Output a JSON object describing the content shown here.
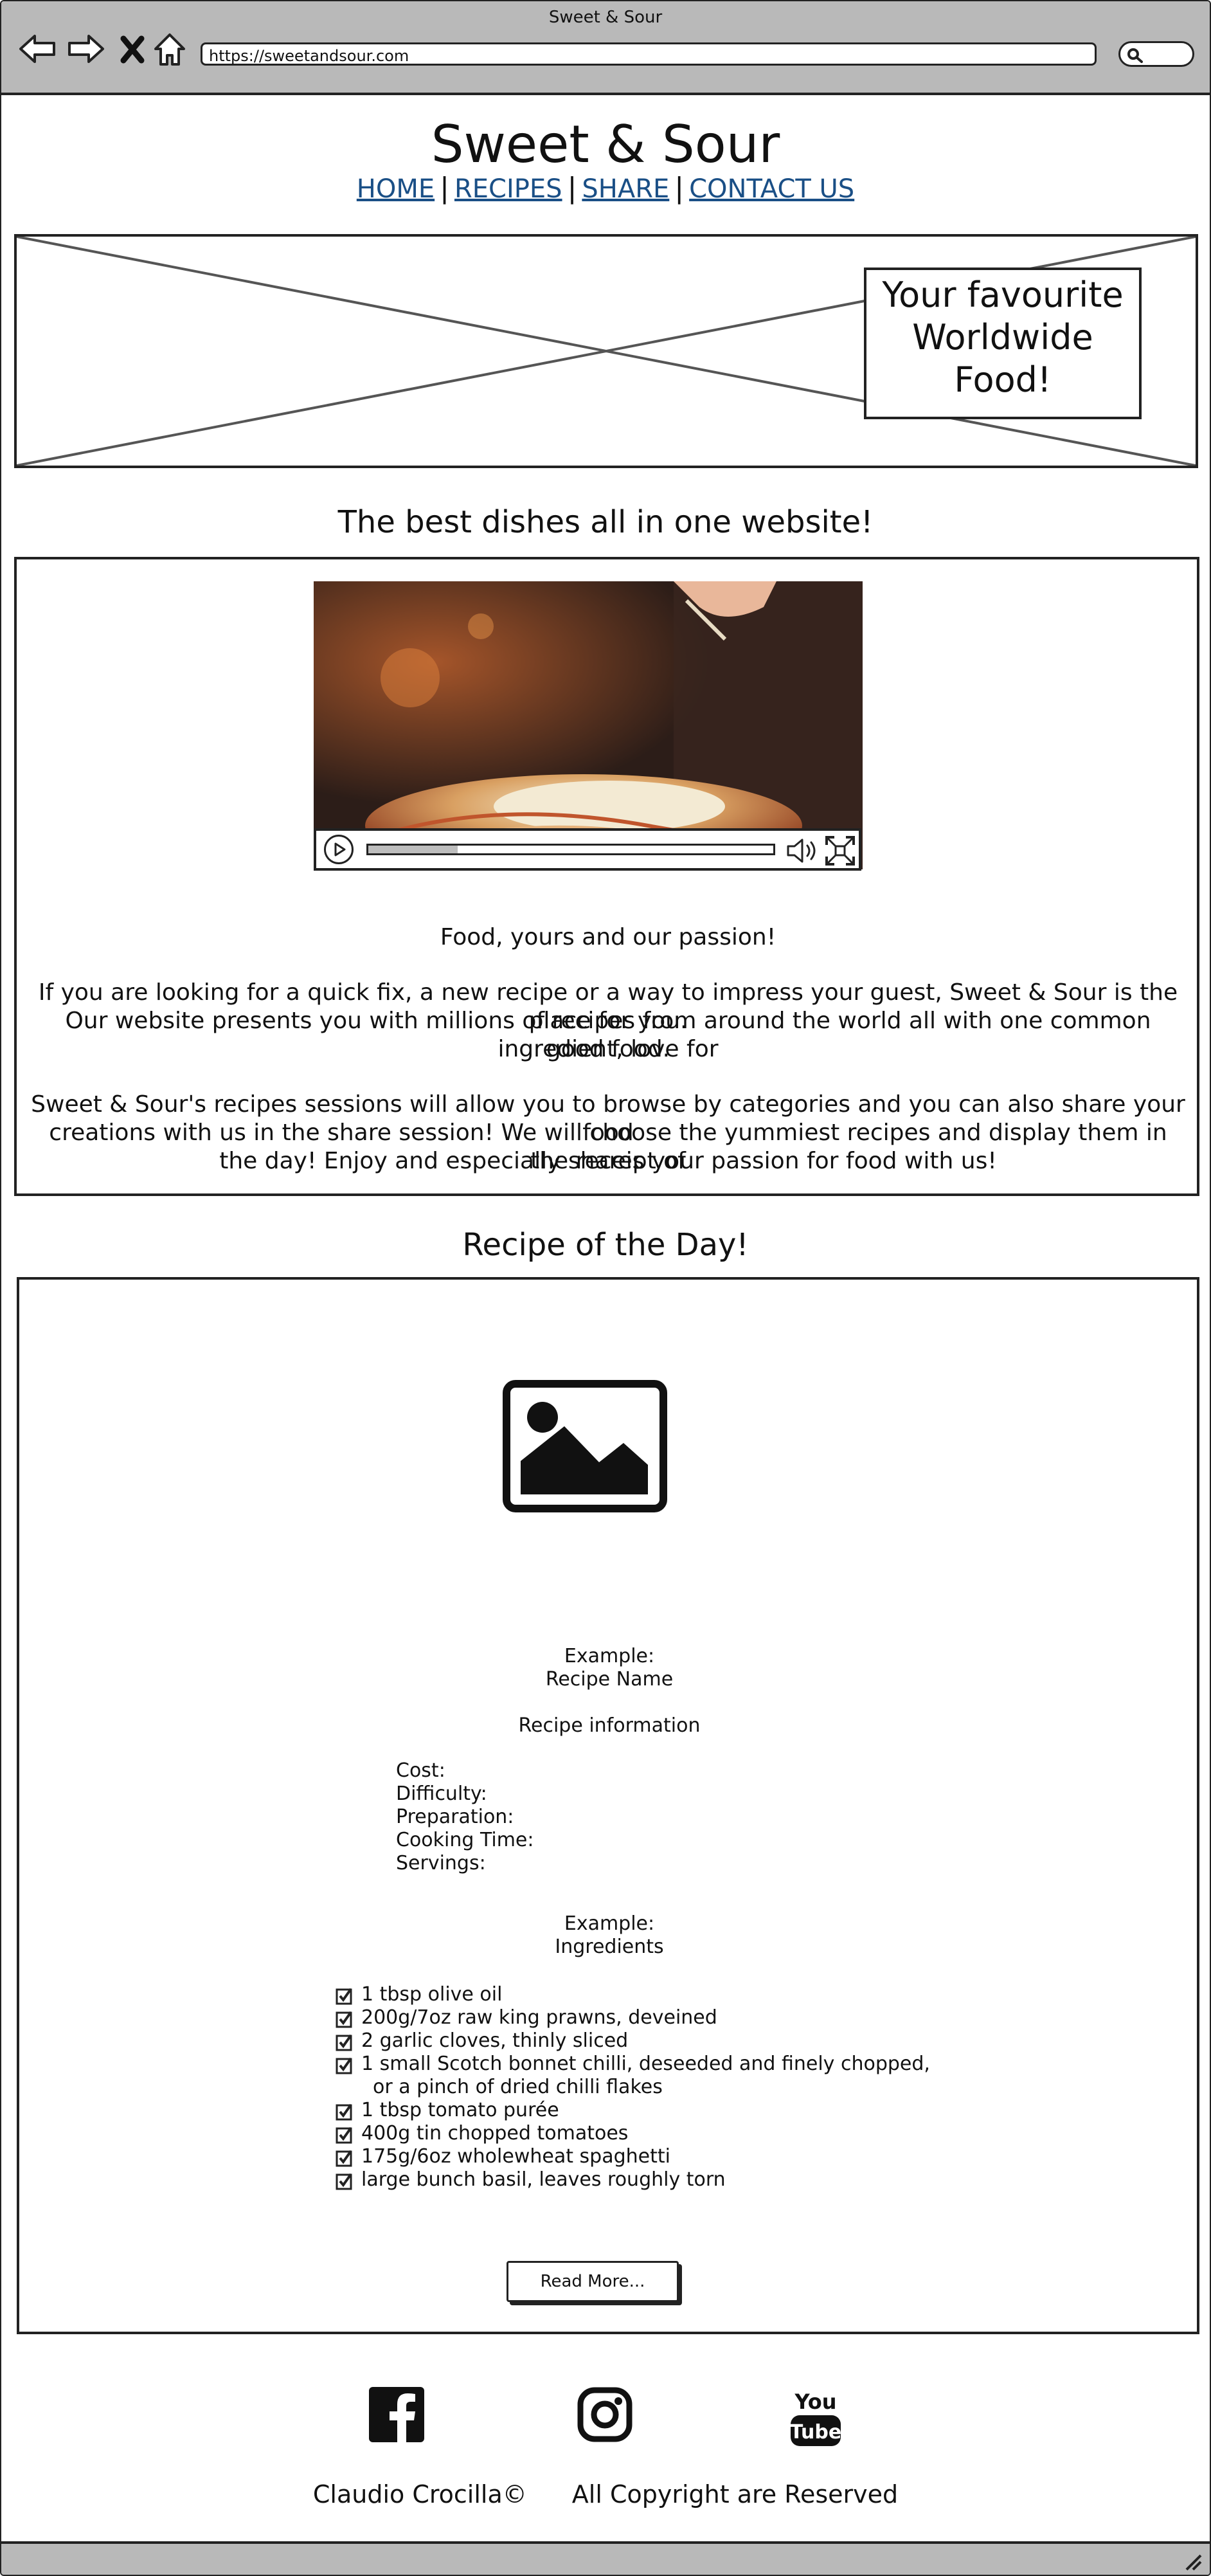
{
  "browser": {
    "window_title": "Sweet & Sour",
    "url": "https://sweetandsour.com",
    "icons": [
      "back-arrow-icon",
      "forward-arrow-icon",
      "close-x-icon",
      "home-icon",
      "search-icon"
    ]
  },
  "header": {
    "site_title": "Sweet & Sour",
    "nav": {
      "home": "HOME",
      "recipes": "RECIPES",
      "share": "SHARE",
      "contact": "CONTACT US",
      "separator": "|"
    }
  },
  "hero": {
    "callout_line1": "Your favourite",
    "callout_line2": "Worldwide",
    "callout_line3": "Food!"
  },
  "intro": {
    "heading": "The best dishes all in one website!",
    "video_progress": 0.22,
    "tagline": "Food, yours and our passion!",
    "para1_line1": "If you are looking for a quick fix, a new recipe or a way to impress your guest, Sweet & Sour is the place for you.",
    "para1_line2": "Our website presents you with millions of recipes from around the world all with one common ingredient, love for",
    "para1_line3": "good food.",
    "para2_line1": "Sweet & Sour's recipes sessions will allow you to browse by categories and you can also share your food",
    "para2_line2": "creations with us in the share session! We will choose the yummiest recipes and display them in the receipt of",
    "para2_line3": "the day! Enjoy and especially shares your passion for food with us!"
  },
  "recipe": {
    "heading": "Recipe of the Day!",
    "example_label": "Example:",
    "name": "Recipe Name",
    "info_heading": "Recipe information",
    "info": [
      "Cost:",
      "Difficulty:",
      "Preparation:",
      "Cooking Time:",
      "Servings:"
    ],
    "ingredients_example_label": "Example:",
    "ingredients_heading": "Ingredients",
    "ingredients": [
      "1 tbsp olive oil",
      "200g/7oz raw king prawns, deveined",
      "2 garlic cloves, thinly sliced",
      "1 small Scotch bonnet chilli, deseeded and finely chopped,",
      "1 tbsp tomato purée",
      "400g tin chopped tomatoes",
      "175g/6oz wholewheat spaghetti",
      "large bunch basil, leaves roughly torn"
    ],
    "ingredient_continuation": "or a pinch of dried chilli flakes",
    "read_more": "Read More..."
  },
  "footer": {
    "author": "Claudio Crocilla",
    "copyright_symbol": "©",
    "rights": "All Copyright are Reserved",
    "youtube_you": "You",
    "youtube_tube": "Tube"
  }
}
